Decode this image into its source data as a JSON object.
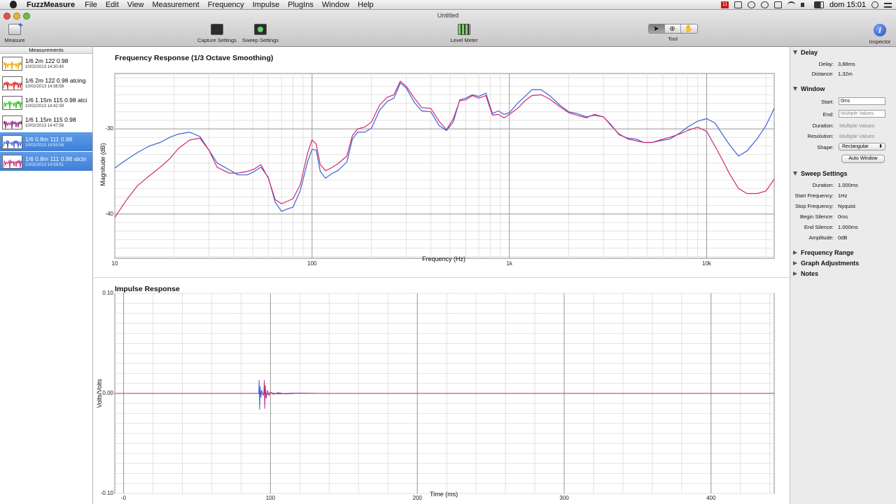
{
  "menubar": {
    "app_name": "FuzzMeasure",
    "items": [
      "File",
      "Edit",
      "View",
      "Measurement",
      "Frequency",
      "Impulse",
      "PlugIns",
      "Window",
      "Help"
    ],
    "clock": "dom 15:01",
    "flag_badge": "11"
  },
  "window": {
    "title": "Untitled"
  },
  "toolbar": {
    "measure": "Measure",
    "capture_settings": "Capture Settings",
    "sweep_settings": "Sweep Settings",
    "level_meter": "Level Meter",
    "tool": "Tool",
    "inspector": "Inspector",
    "inspector_glyph": "i"
  },
  "sidebar": {
    "header": "Measurements",
    "items": [
      {
        "name": "1/6 2m 122 0.98",
        "date": "10/02/2013 14:30:40",
        "color": "#f0a500",
        "selected": false
      },
      {
        "name": "1/6 2m 122 0.98 atcing",
        "date": "10/02/2013 14:36:58",
        "color": "#e21b1b",
        "selected": false
      },
      {
        "name": "1/6 1.15m 115 0.98 atci",
        "date": "10/02/2013 14:42:39",
        "color": "#2cc11f",
        "selected": false
      },
      {
        "name": "1/6 1.15m 115 0.98",
        "date": "10/02/2013 14:47:58",
        "color": "#8e1a7a",
        "selected": false
      },
      {
        "name": "1/6 0.8m 111 0.98",
        "date": "10/02/2013 14:55:56",
        "color": "#2f57c9",
        "selected": true
      },
      {
        "name": "1/6 0.8m 111 0.98 atcin",
        "date": "10/02/2013 14:59:51",
        "color": "#c22b7e",
        "selected": true
      }
    ]
  },
  "chart_data": [
    {
      "type": "line",
      "title": "Frequency Response (1/3 Octave Smoothing)",
      "xlabel": "Frequency (Hz)",
      "ylabel": "Magnitude (dB)",
      "xscale": "log",
      "xlim": [
        10,
        22000
      ],
      "ylim": [
        -45.2,
        -23.5
      ],
      "xticks": [
        {
          "v": 10,
          "label": "10"
        },
        {
          "v": 100,
          "label": "100"
        },
        {
          "v": 1000,
          "label": "1k"
        },
        {
          "v": 10000,
          "label": "10k"
        }
      ],
      "yticks": [
        {
          "v": -30,
          "label": "-30"
        },
        {
          "v": -40,
          "label": "-40"
        }
      ],
      "grid": true,
      "series": [
        {
          "color": "#3b64d6",
          "x": [
            10,
            11.5,
            13,
            15,
            17,
            19,
            21,
            24,
            27,
            30,
            33,
            38,
            42,
            47,
            51,
            55,
            60,
            65,
            70,
            75,
            80,
            87,
            95,
            100,
            105,
            110,
            117,
            125,
            135,
            150,
            160,
            170,
            185,
            200,
            220,
            240,
            260,
            280,
            300,
            330,
            360,
            400,
            440,
            480,
            520,
            560,
            600,
            650,
            700,
            760,
            820,
            880,
            940,
            1000,
            1100,
            1200,
            1300,
            1450,
            1600,
            1800,
            2000,
            2200,
            2450,
            2700,
            3000,
            3300,
            3600,
            4000,
            4400,
            4800,
            5300,
            5800,
            6500,
            7300,
            8000,
            9000,
            10000,
            11000,
            12000,
            13000,
            14500,
            16000,
            18000,
            20000,
            22000
          ],
          "y": [
            -34.6,
            -33.6,
            -32.8,
            -32,
            -31.6,
            -31,
            -30.6,
            -30.4,
            -30.9,
            -32.5,
            -34,
            -34.8,
            -35.4,
            -35.4,
            -35,
            -34.5,
            -35.7,
            -38.6,
            -39.7,
            -39.4,
            -39.2,
            -37.3,
            -33.8,
            -32.4,
            -32.5,
            -35,
            -35.8,
            -35.3,
            -34.9,
            -33.9,
            -31.2,
            -30.4,
            -30.4,
            -29.9,
            -27.8,
            -26.8,
            -26.4,
            -24.6,
            -25.2,
            -26.9,
            -27.9,
            -28,
            -29.6,
            -30.2,
            -29.2,
            -26.6,
            -26.4,
            -26,
            -26.2,
            -25.8,
            -28.2,
            -27.9,
            -28.3,
            -28.1,
            -27,
            -26.2,
            -25.4,
            -25.4,
            -26.1,
            -27.2,
            -28,
            -28.2,
            -28.6,
            -28.4,
            -28.6,
            -29.6,
            -30.7,
            -31.1,
            -31.2,
            -31.6,
            -31.6,
            -31.4,
            -31.2,
            -30.5,
            -29.8,
            -29.1,
            -28.8,
            -29.3,
            -30.6,
            -31.8,
            -33.2,
            -32.6,
            -31.2,
            -29.6,
            -27.6
          ]
        },
        {
          "color": "#d02a73",
          "x": [
            10,
            11.5,
            13,
            15,
            17,
            19,
            21,
            24,
            27,
            30,
            33,
            38,
            42,
            47,
            51,
            55,
            60,
            65,
            70,
            75,
            80,
            87,
            95,
            100,
            105,
            110,
            117,
            125,
            135,
            150,
            160,
            170,
            185,
            200,
            220,
            240,
            260,
            280,
            300,
            330,
            360,
            400,
            440,
            480,
            520,
            560,
            600,
            650,
            700,
            760,
            820,
            880,
            940,
            1000,
            1100,
            1200,
            1300,
            1450,
            1600,
            1800,
            2000,
            2200,
            2450,
            2700,
            3000,
            3300,
            3600,
            4000,
            4400,
            4800,
            5300,
            5800,
            6500,
            7300,
            8000,
            9000,
            10000,
            11000,
            12000,
            13000,
            14500,
            16000,
            18000,
            20000,
            22000
          ],
          "y": [
            -40.4,
            -38.3,
            -36.7,
            -35.5,
            -34.5,
            -33.5,
            -32.3,
            -31.3,
            -31.1,
            -32.5,
            -34.5,
            -35.2,
            -35.2,
            -35,
            -34.7,
            -34.2,
            -35.8,
            -38.3,
            -38.8,
            -38.5,
            -38.2,
            -36.6,
            -32.8,
            -31.3,
            -31.8,
            -34.2,
            -34.9,
            -34.6,
            -34.1,
            -33.2,
            -30.8,
            -30,
            -29.8,
            -29.2,
            -27.2,
            -26.3,
            -26,
            -24.4,
            -25,
            -26.4,
            -27.5,
            -27.6,
            -29.1,
            -30.1,
            -28.8,
            -26.7,
            -26.6,
            -26.1,
            -26.4,
            -26.1,
            -28.4,
            -28.3,
            -28.7,
            -28.3,
            -27.6,
            -26.7,
            -26.1,
            -26,
            -26.5,
            -27.4,
            -28.1,
            -28.4,
            -28.7,
            -28.3,
            -28.6,
            -29.7,
            -30.6,
            -31.2,
            -31.4,
            -31.6,
            -31.6,
            -31.3,
            -31,
            -30.6,
            -30.2,
            -29.8,
            -30.3,
            -32,
            -33.6,
            -35.2,
            -37,
            -37.6,
            -37.6,
            -37.3,
            -35.9
          ]
        }
      ]
    },
    {
      "type": "line",
      "title": "Impulse Response",
      "xlabel": "Time (ms)",
      "ylabel": "Volts/Volts",
      "xlim": [
        -6,
        443
      ],
      "ylim": [
        -0.1,
        0.1
      ],
      "xticks": [
        {
          "v": 0,
          "label": "-0"
        },
        {
          "v": 100,
          "label": "100"
        },
        {
          "v": 200,
          "label": "200"
        },
        {
          "v": 300,
          "label": "300"
        },
        {
          "v": 400,
          "label": "400"
        }
      ],
      "yticks": [
        {
          "v": 0.1,
          "label": "0.10"
        },
        {
          "v": 0,
          "label": "0.00"
        },
        {
          "v": -0.1,
          "label": "-0.10"
        }
      ],
      "grid": true,
      "series": [
        {
          "color": "#3b64d6",
          "x": [
            -6,
            88,
            92,
            92.3,
            92.6,
            93,
            93.5,
            94,
            95,
            96,
            98,
            100,
            105,
            115,
            130,
            443
          ],
          "y": [
            0,
            0,
            0,
            0.013,
            -0.016,
            0.007,
            -0.004,
            0.003,
            -0.002,
            0.002,
            -0.001,
            0.0007,
            -0.0005,
            0.0003,
            0,
            0
          ]
        },
        {
          "color": "#c0297d",
          "x": [
            -6,
            93,
            95.5,
            95.8,
            96.1,
            96.5,
            97,
            98,
            99,
            100,
            102,
            105,
            110,
            120,
            135,
            443
          ],
          "y": [
            0,
            0,
            0,
            0.013,
            -0.015,
            0.008,
            -0.005,
            0.003,
            -0.002,
            0.0015,
            -0.001,
            0.0008,
            -0.0005,
            0.0003,
            0,
            0
          ]
        }
      ]
    }
  ],
  "inspector": {
    "delay": {
      "header": "Delay",
      "delay_label": "Delay:",
      "delay_value": "3,88ms",
      "distance_label": "Distance:",
      "distance_value": "1,32m"
    },
    "window": {
      "header": "Window",
      "start_label": "Start:",
      "start_value": "0ms",
      "end_label": "End:",
      "end_placeholder": "Multiple Values",
      "duration_label": "Duration:",
      "duration_value": "Multiple Values",
      "resolution_label": "Resolution:",
      "resolution_value": "Multiple Values",
      "shape_label": "Shape:",
      "shape_value": "Rectangular",
      "auto_window": "Auto Window"
    },
    "sweep": {
      "header": "Sweep Settings",
      "duration_label": "Duration:",
      "duration_value": "1.000ms",
      "start_freq_label": "Start Frequency:",
      "start_freq_value": "1Hz",
      "stop_freq_label": "Stop Frequency:",
      "stop_freq_value": "Nyquist",
      "begin_silence_label": "Begin Silence:",
      "begin_silence_value": "0ms",
      "end_silence_label": "End Silence:",
      "end_silence_value": "1.000ms",
      "amplitude_label": "Amplitude:",
      "amplitude_value": "0dB"
    },
    "collapsed": [
      "Frequency Range",
      "Graph Adjustments",
      "Notes"
    ]
  }
}
